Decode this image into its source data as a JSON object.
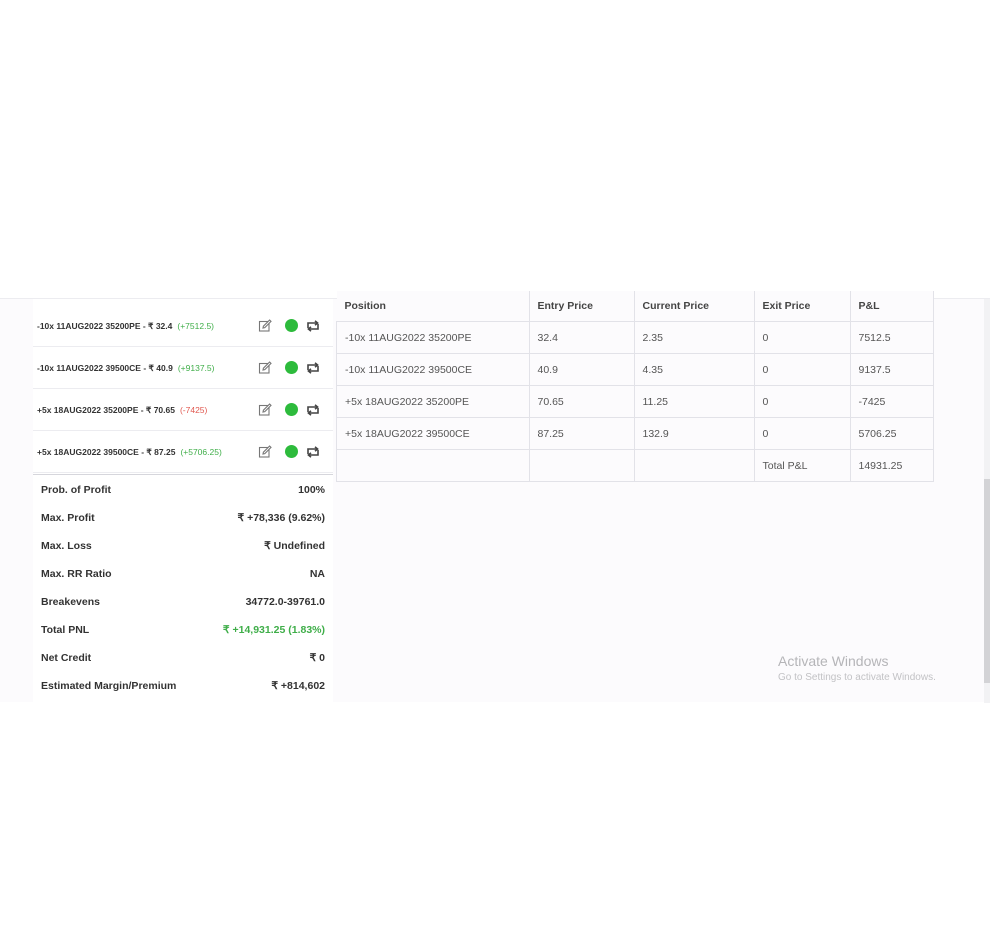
{
  "legs": [
    {
      "label": "-10x  11AUG2022  35200PE  - ₹ 32.4",
      "pnl": "(+7512.5)",
      "pnl_sign": "pos"
    },
    {
      "label": "-10x  11AUG2022  39500CE  - ₹ 40.9",
      "pnl": "(+9137.5)",
      "pnl_sign": "pos"
    },
    {
      "label": "+5x  18AUG2022  35200PE  - ₹ 70.65",
      "pnl": "(-7425)",
      "pnl_sign": "neg"
    },
    {
      "label": "+5x  18AUG2022  39500CE  - ₹ 87.25",
      "pnl": "(+5706.25)",
      "pnl_sign": "pos"
    }
  ],
  "stats": [
    {
      "label": "Prob. of Profit",
      "value": "100%",
      "color": ""
    },
    {
      "label": "Max. Profit",
      "value": "₹ +78,336 (9.62%)",
      "color": ""
    },
    {
      "label": "Max. Loss",
      "value": "₹ Undefined",
      "color": ""
    },
    {
      "label": "Max. RR Ratio",
      "value": "NA",
      "color": ""
    },
    {
      "label": "Breakevens",
      "value": "34772.0-39761.0",
      "color": ""
    },
    {
      "label": "Total PNL",
      "value": "₹ +14,931.25 (1.83%)",
      "color": "pos"
    },
    {
      "label": "Net Credit",
      "value": "₹ 0",
      "color": ""
    },
    {
      "label": "Estimated Margin/Premium",
      "value": "₹ +814,602",
      "color": ""
    }
  ],
  "table": {
    "headers": [
      "Position",
      "Entry Price",
      "Current Price",
      "Exit Price",
      "P&L"
    ],
    "rows": [
      [
        "-10x 11AUG2022 35200PE",
        "32.4",
        "2.35",
        "0",
        "7512.5"
      ],
      [
        "-10x 11AUG2022 39500CE",
        "40.9",
        "4.35",
        "0",
        "9137.5"
      ],
      [
        "+5x 18AUG2022 35200PE",
        "70.65",
        "11.25",
        "0",
        "-7425"
      ],
      [
        "+5x 18AUG2022 39500CE",
        "87.25",
        "132.9",
        "0",
        "5706.25"
      ]
    ],
    "total_label": "Total P&L",
    "total_value": "14931.25"
  },
  "watermark": {
    "title": "Activate Windows",
    "subtitle": "Go to Settings to activate Windows."
  },
  "icons": {
    "edit": "edit-icon",
    "status": "status-dot-icon",
    "swap": "swap-icon"
  },
  "colors": {
    "positive": "#3fae49",
    "negative": "#e0584f",
    "status_dot": "#2dbb3c"
  }
}
